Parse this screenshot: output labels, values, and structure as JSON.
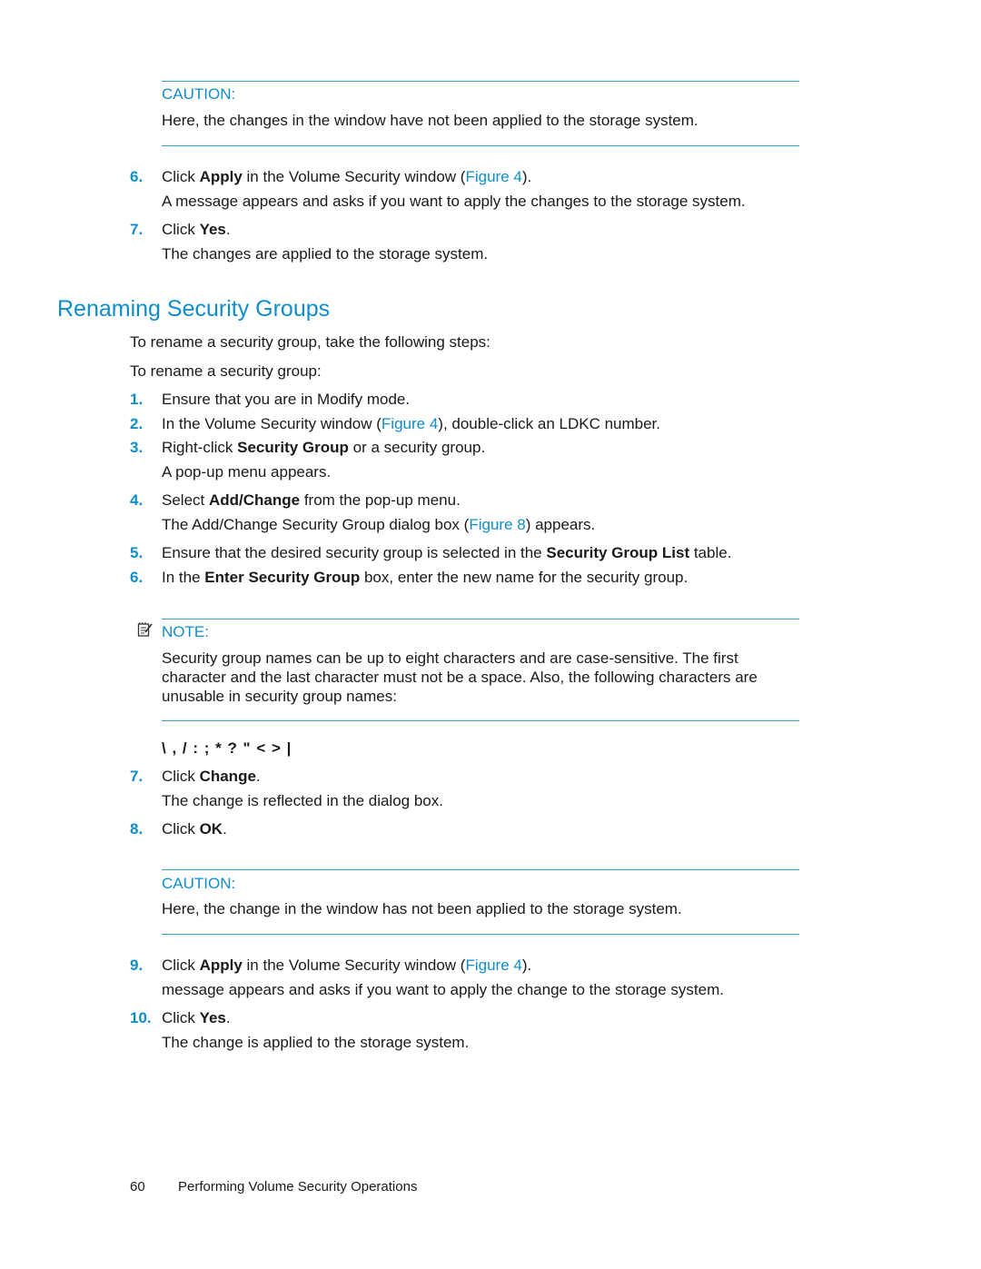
{
  "caution1": {
    "label": "CAUTION:",
    "text": "Here, the changes in the window have not been applied to the storage system."
  },
  "steps_a": [
    {
      "num": "6.",
      "pre": "Click ",
      "bold": "Apply",
      "mid": " in the Volume Security window (",
      "link": "Figure 4",
      "post": ").",
      "sub": "A message appears and asks if you want to apply the changes to the storage system."
    },
    {
      "num": "7.",
      "pre": "Click ",
      "bold": "Yes",
      "post": ".",
      "sub": "The changes are applied to the storage system."
    }
  ],
  "section": {
    "title": "Renaming Security Groups",
    "intro1": "To rename a security group, take the following steps:",
    "intro2": "To rename a security group:"
  },
  "steps_b": [
    {
      "num": "1.",
      "text": "Ensure that you are in Modify mode."
    },
    {
      "num": "2.",
      "pre": "In the Volume Security window (",
      "link": "Figure 4",
      "post": "), double-click an LDKC number."
    },
    {
      "num": "3.",
      "pre": "Right-click ",
      "bold": "Security Group",
      "post": " or a security group.",
      "sub": "A pop-up menu appears."
    },
    {
      "num": "4.",
      "pre": "Select ",
      "bold": "Add/Change",
      "post": " from the pop-up menu.",
      "sub_pre": "The Add/Change Security Group dialog box (",
      "sub_link": "Figure 8",
      "sub_post": ") appears."
    },
    {
      "num": "5.",
      "pre": "Ensure that the desired security group is selected in the ",
      "bold": "Security Group List",
      "post": " table."
    },
    {
      "num": "6.",
      "pre": "In the ",
      "bold": "Enter Security Group",
      "post": " box, enter the new name for the security group."
    }
  ],
  "note": {
    "icon": "note-icon",
    "label": "NOTE:",
    "text": "Security group names can be up to eight characters and are case-sensitive. The first character and the last character must not be a space. Also, the following characters are unusable in security group names:"
  },
  "special_chars": "\\ , / : ; * ? \" < > |",
  "steps_c": [
    {
      "num": "7.",
      "pre": "Click ",
      "bold": "Change",
      "post": ".",
      "sub": "The change is reflected in the dialog box."
    },
    {
      "num": "8.",
      "pre": "Click ",
      "bold": "OK",
      "post": "."
    }
  ],
  "caution2": {
    "label": "CAUTION:",
    "text": "Here, the change in the window has not been applied to the storage system."
  },
  "steps_d": [
    {
      "num": "9.",
      "pre": "Click ",
      "bold": "Apply",
      "mid": " in the Volume Security window (",
      "link": "Figure 4",
      "post": ").",
      "sub": "message appears and asks if you want to apply the change to the storage system."
    },
    {
      "num": "10.",
      "pre": "Click ",
      "bold": "Yes",
      "post": ".",
      "sub": "The change is applied to the storage system."
    }
  ],
  "footer": {
    "page_number": "60",
    "chapter": "Performing Volume Security Operations"
  }
}
